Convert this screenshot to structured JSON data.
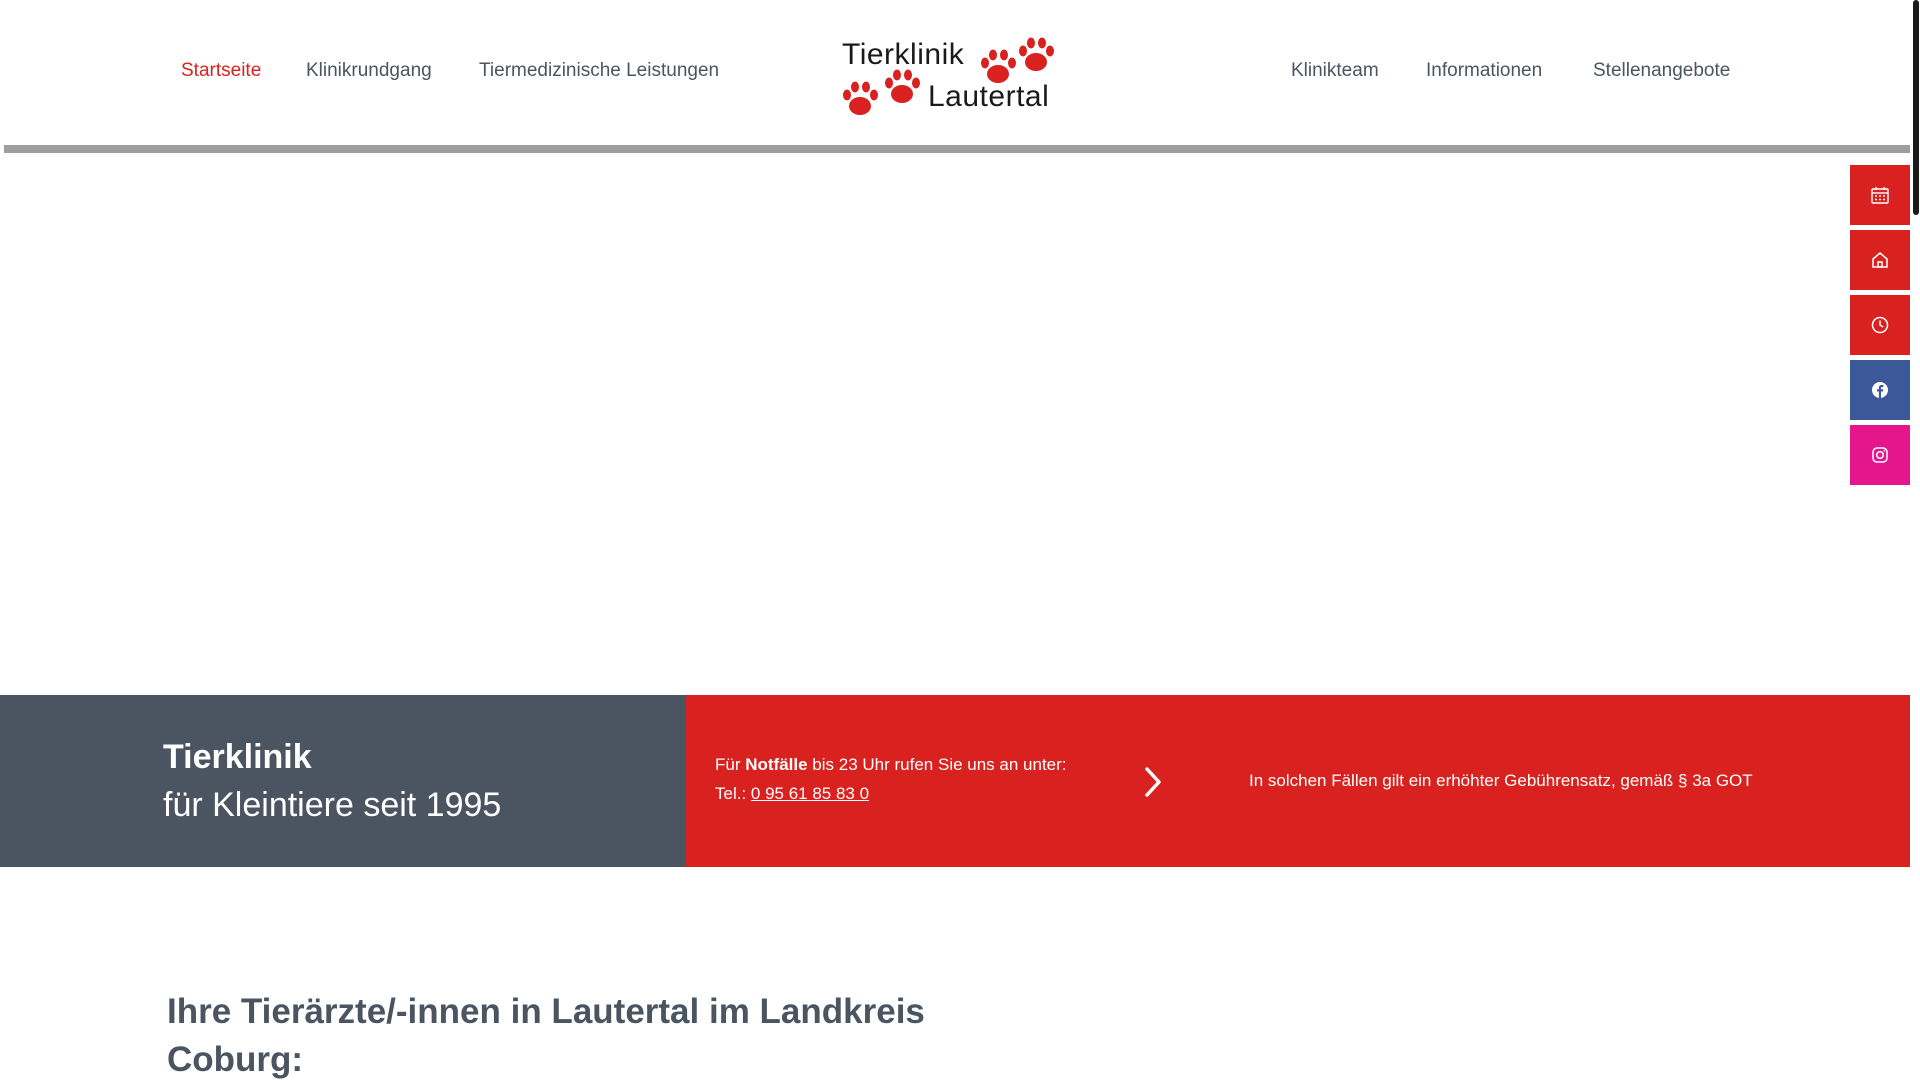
{
  "nav": {
    "left": [
      {
        "label": "Startseite",
        "active": true
      },
      {
        "label": "Klinikrundgang",
        "active": false
      },
      {
        "label": "Tiermedizinische Leistungen",
        "active": false
      }
    ],
    "right": [
      {
        "label": "Klinikteam",
        "active": false
      },
      {
        "label": "Informationen",
        "active": false
      },
      {
        "label": "Stellenangebote",
        "active": false
      }
    ]
  },
  "logo": {
    "line1": "Tierklinik",
    "line2": "Lautertal"
  },
  "side_buttons": [
    {
      "icon": "calendar-icon",
      "color": "#d9221f"
    },
    {
      "icon": "home-icon",
      "color": "#d9221f"
    },
    {
      "icon": "clock-icon",
      "color": "#d9221f"
    },
    {
      "icon": "facebook-icon",
      "color": "#3b5998"
    },
    {
      "icon": "instagram-icon",
      "color": "#e5158c"
    }
  ],
  "band": {
    "title": "Tierklinik",
    "subtitle": "für Kleintiere seit 1995",
    "emergency_prefix": "Für ",
    "emergency_bold": "Notfälle",
    "emergency_suffix": " bis 23 Uhr rufen Sie uns an unter:",
    "phone_prefix": "Tel.: ",
    "phone": "0 95 61 85 83 0",
    "fee_note": "In solchen Fällen gilt ein erhöhter Gebührensatz, gemäß § 3a GOT"
  },
  "main": {
    "heading": "Ihre Tierärzte/-innen in Lautertal im Landkreis Coburg:"
  },
  "colors": {
    "accent": "#d9221f",
    "slate": "#4a5561",
    "facebook": "#3b5998",
    "instagram": "#e5158c"
  }
}
